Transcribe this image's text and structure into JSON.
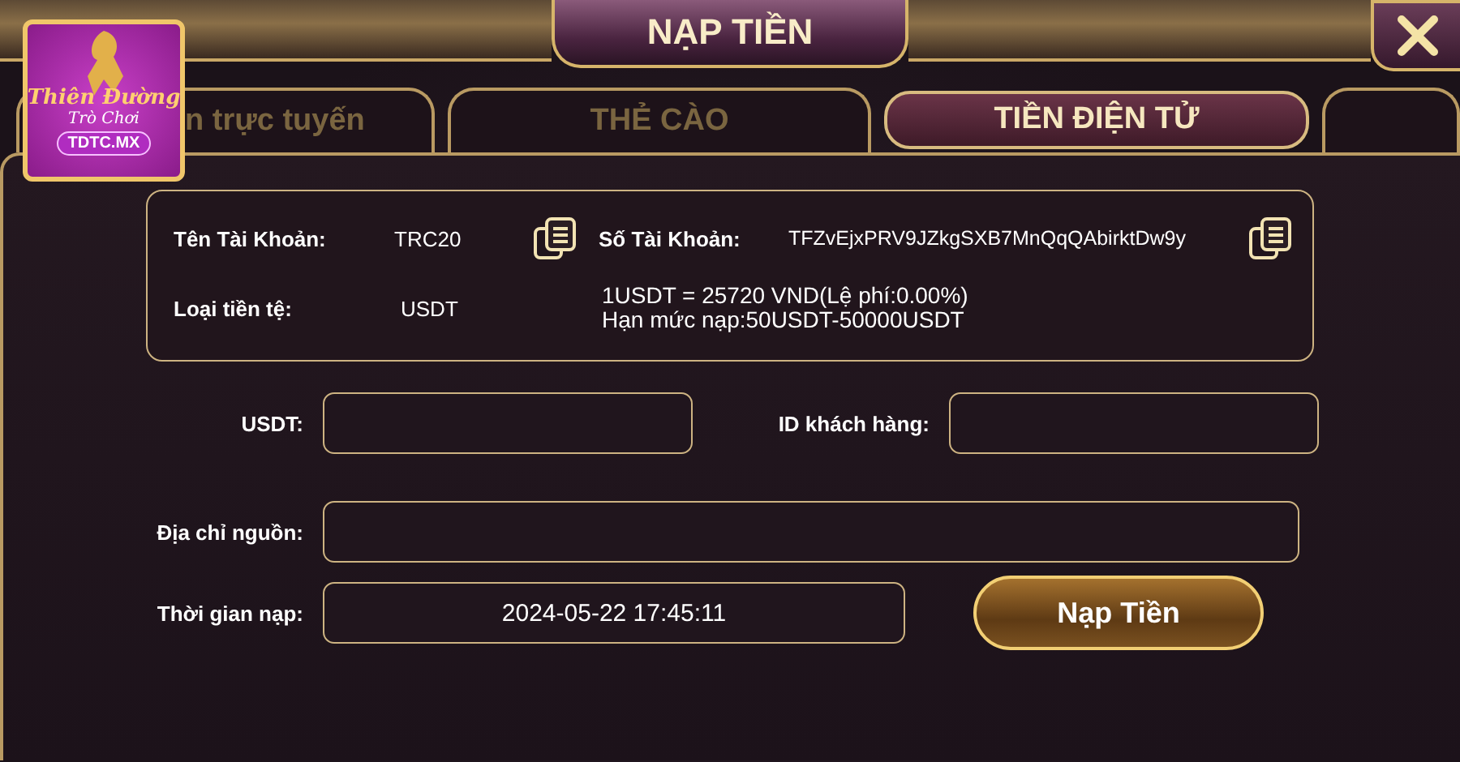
{
  "window": {
    "title": "NẠP TIỀN"
  },
  "logo": {
    "line_1": "Thiên Đường",
    "line_2": "Trò Chơi",
    "badge": "TDTC.MX"
  },
  "tabs": [
    {
      "label": "n trực tuyến",
      "selected": false
    },
    {
      "label": "THẺ CÀO",
      "selected": false
    },
    {
      "label": "TIỀN ĐIỆN TỬ",
      "selected": true
    },
    {
      "selected": false
    }
  ],
  "account_info": {
    "account_name": {
      "label": "Tên Tài Khoản:",
      "value": "TRC20"
    },
    "account_number": {
      "label": "Số Tài Khoản:",
      "value": "TFZvEjxPRV9JZkgSXB7MnQqQAbirktDw9y"
    },
    "currency": {
      "label": "Loại tiền tệ:",
      "value": "USDT"
    },
    "rate_lines": [
      "1USDT = 25720 VND(Lệ phí:0.00%)",
      "Hạn mức nạp:50USDT-50000USDT"
    ]
  },
  "form": {
    "fields": [
      {
        "label": "USDT:"
      },
      {
        "label": "ID khách hàng:"
      },
      {
        "label": "Địa chỉ nguồn:"
      },
      {
        "label": "Thời gian nạp:",
        "value": "2024-05-22 17:45:11"
      }
    ],
    "submit": "Nạp Tiền"
  }
}
